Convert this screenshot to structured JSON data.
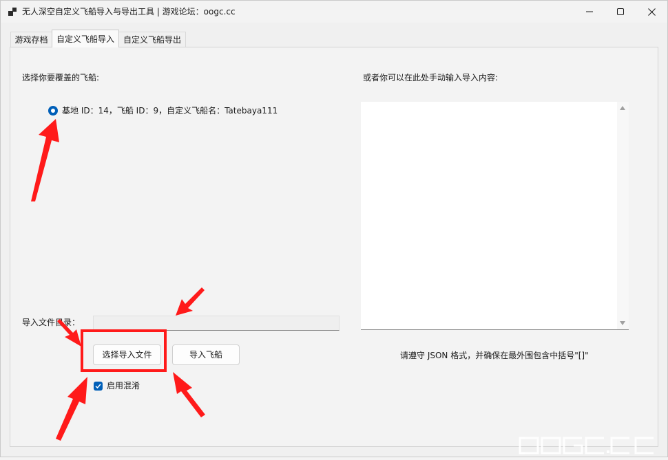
{
  "window": {
    "title": "无人深空自定义飞船导入与导出工具 | 游戏论坛：oogc.cc"
  },
  "tabs": [
    {
      "label": "游戏存档",
      "active": false
    },
    {
      "label": "自定义飞船导入",
      "active": true
    },
    {
      "label": "自定义飞船导出",
      "active": false
    }
  ],
  "left": {
    "select_label": "选择你要覆盖的飞船:",
    "ship_option": "基地 ID：14，飞船 ID：9，自定义飞船名：Tatebaya111",
    "dir_label": "导入文件目录：",
    "dir_value": "",
    "choose_file_button": "选择导入文件",
    "import_button": "导入飞船",
    "obfuscate_label": "启用混淆",
    "obfuscate_checked": true
  },
  "right": {
    "manual_label": "或者你可以在此处手动输入导入内容:",
    "manual_content": "",
    "hint": "请遵守 JSON 格式，并确保在最外围包含中括号\"[]\""
  },
  "watermark": "oogc.cc",
  "colors": {
    "accent": "#005fb8",
    "annotation": "#ff1a1a"
  }
}
